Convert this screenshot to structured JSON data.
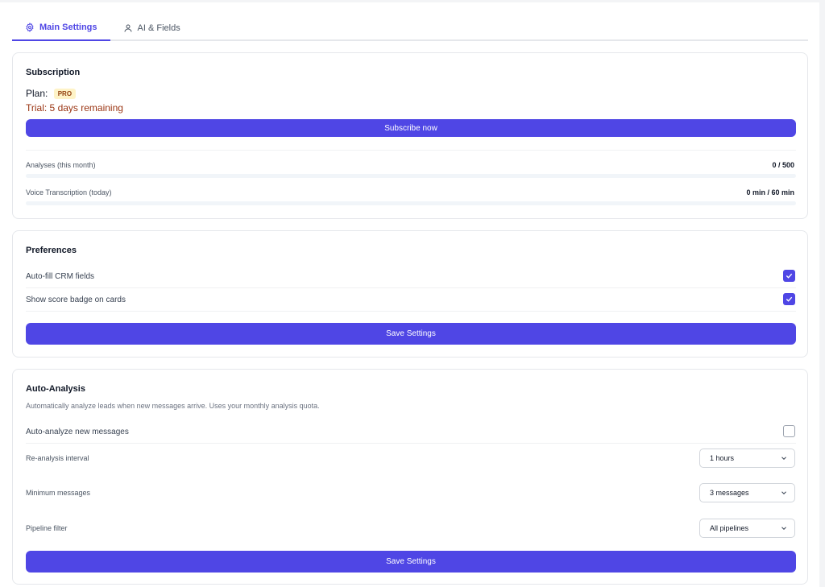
{
  "tabs": [
    {
      "label": "Main Settings",
      "icon": "gear-icon",
      "active": true
    },
    {
      "label": "AI & Fields",
      "icon": "user-icon",
      "active": false
    }
  ],
  "subscription": {
    "title": "Subscription",
    "plan_label": "Plan:",
    "plan_badge": "PRO",
    "trial_text": "Trial: 5 days remaining",
    "subscribe_button": "Subscribe now",
    "usage": [
      {
        "label": "Analyses (this month)",
        "value": "0 / 500",
        "fraction": 0
      },
      {
        "label": "Voice Transcription (today)",
        "value": "0 min / 60 min",
        "fraction": 0
      }
    ]
  },
  "preferences": {
    "title": "Preferences",
    "options": [
      {
        "label": "Auto-fill CRM fields",
        "checked": true
      },
      {
        "label": "Show score badge on cards",
        "checked": true
      }
    ],
    "save_button": "Save Settings"
  },
  "auto_analysis": {
    "title": "Auto-Analysis",
    "description": "Automatically analyze leads when new messages arrive. Uses your monthly analysis quota.",
    "toggle_label": "Auto-analyze new messages",
    "toggle_checked": false,
    "settings": [
      {
        "label": "Re-analysis interval",
        "value": "1 hours"
      },
      {
        "label": "Minimum messages",
        "value": "3 messages"
      },
      {
        "label": "Pipeline filter",
        "value": "All pipelines"
      }
    ],
    "save_button": "Save Settings"
  },
  "colors": {
    "accent": "#4f46e5",
    "trial_text": "#9a3412",
    "badge_bg": "#fef3c7"
  }
}
